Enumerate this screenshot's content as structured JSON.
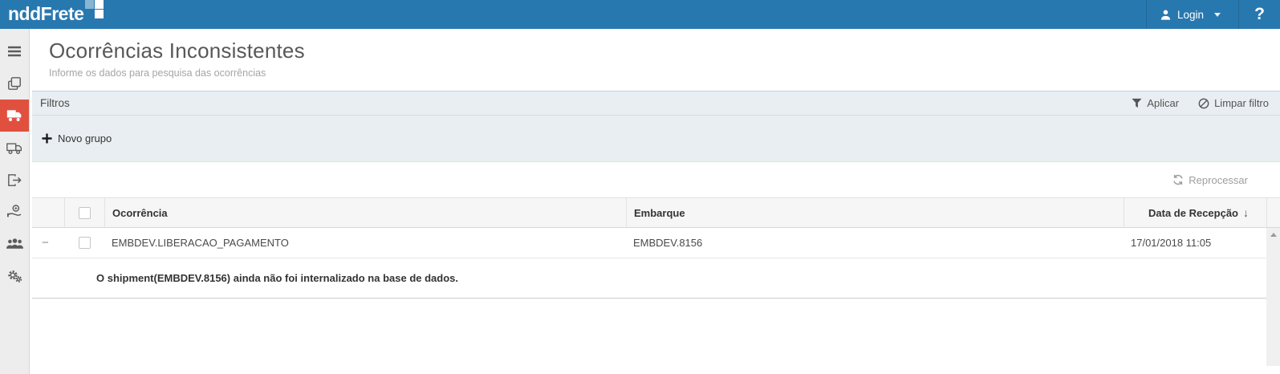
{
  "topbar": {
    "logo": "nddFrete",
    "login_label": "Login",
    "help_label": "?"
  },
  "sidebar": {
    "items": [
      {
        "icon": "menu-icon",
        "active": false
      },
      {
        "icon": "documents-icon",
        "active": false
      },
      {
        "icon": "truck-icon",
        "active": true
      },
      {
        "icon": "delivery-truck-icon",
        "active": false
      },
      {
        "icon": "sign-out-icon",
        "active": false
      },
      {
        "icon": "payment-hand-icon",
        "active": false
      },
      {
        "icon": "users-icon",
        "active": false
      },
      {
        "icon": "settings-gears-icon",
        "active": false
      }
    ]
  },
  "page": {
    "title": "Ocorrências Inconsistentes",
    "subtitle": "Informe os dados para pesquisa das ocorrências"
  },
  "filters": {
    "title": "Filtros",
    "apply_label": "Aplicar",
    "clear_label": "Limpar filtro",
    "new_group_label": "Novo grupo"
  },
  "toolbar": {
    "reprocess_label": "Reprocessar"
  },
  "table": {
    "columns": {
      "ocorrencia": "Ocorrência",
      "embarque": "Embarque",
      "data_recepcao": "Data de Recepção"
    },
    "sort": {
      "column": "Data de Recepção",
      "direction": "desc",
      "indicator": "↓"
    },
    "rows": [
      {
        "expand": "−",
        "ocorrencia": "EMBDEV.LIBERACAO_PAGAMENTO",
        "embarque": "EMBDEV.8156",
        "data_recepcao": "17/01/2018 11:05",
        "detail": "O shipment(EMBDEV.8156) ainda não foi internalizado na base de dados."
      }
    ]
  },
  "colors": {
    "topbar_blue": "#2878b0",
    "active_item_red": "#e1503f",
    "band_background": "#e8eef1",
    "header_background": "#f6f6f6"
  }
}
